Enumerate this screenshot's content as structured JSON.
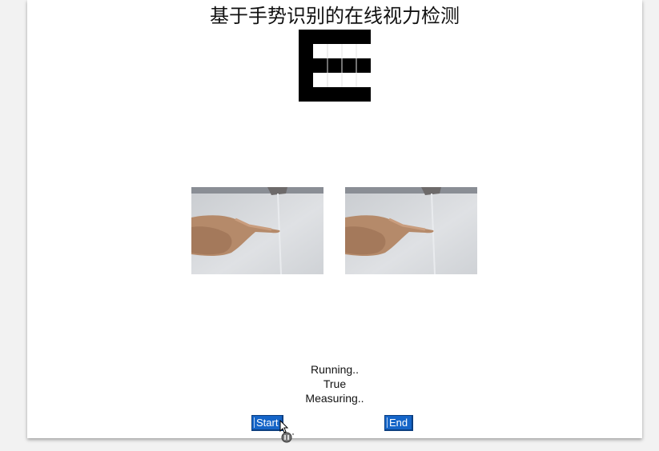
{
  "page": {
    "title": "基于手势识别的在线视力检测"
  },
  "optotype": {
    "icon": "tumbling-e-icon",
    "direction": "right",
    "color": "#000000"
  },
  "camera_feeds": [
    {
      "icon": "camera-feed-hand-pointing-right"
    },
    {
      "icon": "camera-feed-hand-pointing-right"
    }
  ],
  "status": {
    "line1": "Running..",
    "line2": "True",
    "line3": "Measuring.."
  },
  "buttons": {
    "start_label": "Start",
    "end_label": "End",
    "color": "#1565c8"
  },
  "cursor": {
    "icon": "busy-pointer-icon"
  }
}
